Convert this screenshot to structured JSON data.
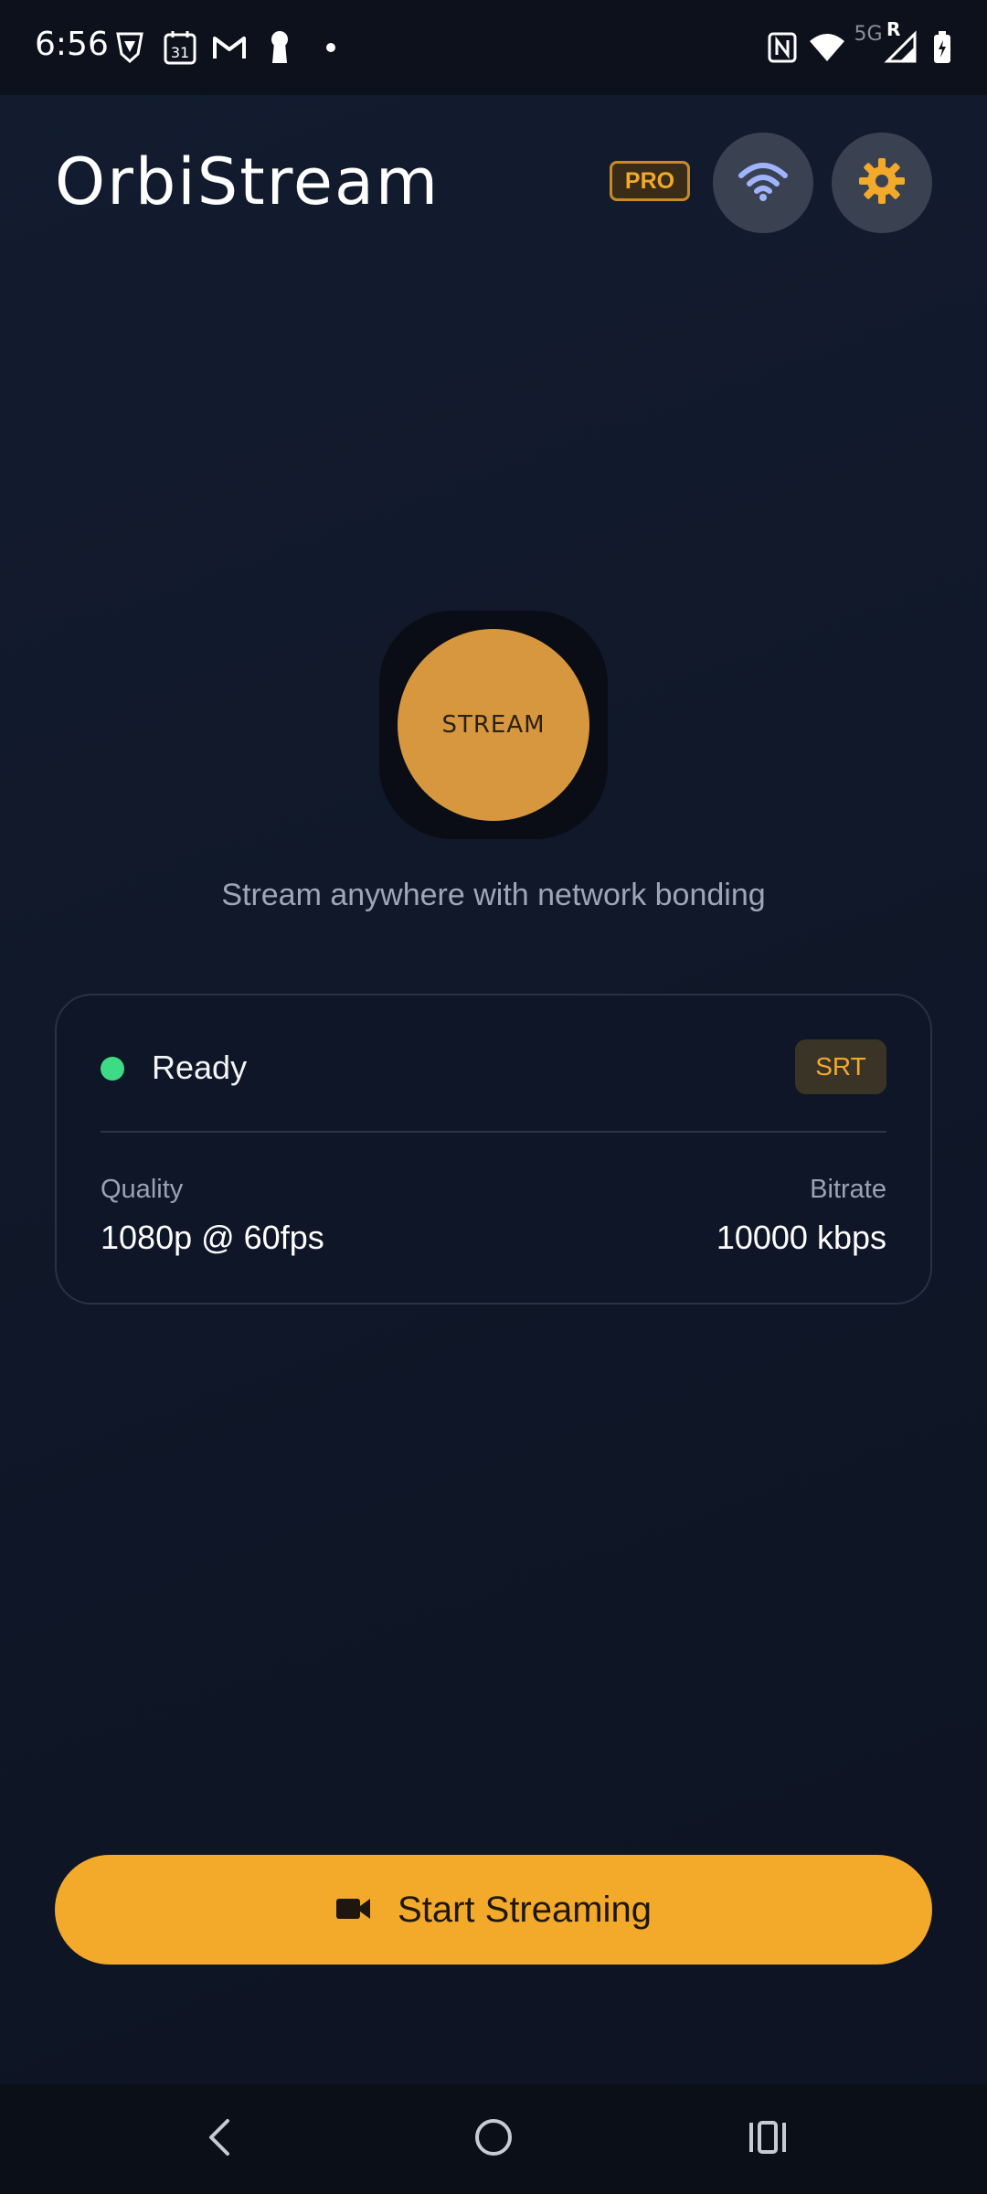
{
  "status_bar": {
    "time": "6:56",
    "left_icons": [
      "brave-icon",
      "calendar-icon",
      "gmail-icon",
      "keyhole-icon",
      "dot-icon"
    ],
    "calendar_day": "31",
    "network_label": "5G",
    "roaming_label": "R",
    "right_icons": [
      "nfc-icon",
      "wifi-icon",
      "cellular-signal-icon",
      "battery-charging-icon"
    ]
  },
  "header": {
    "title": "OrbiStream",
    "pro_badge": "PRO",
    "wifi_button_icon": "wifi-icon",
    "settings_button_icon": "gear-icon"
  },
  "hero": {
    "logo_text": "STREAM",
    "tagline": "Stream anywhere with network bonding"
  },
  "status_card": {
    "status": "Ready",
    "protocol": "SRT",
    "quality_label": "Quality",
    "quality_value": "1080p @ 60fps",
    "bitrate_label": "Bitrate",
    "bitrate_value": "10000 kbps"
  },
  "start_button": {
    "label": "Start Streaming",
    "icon": "video-camera-icon"
  },
  "nav": {
    "items": [
      "back-icon",
      "home-icon",
      "recents-icon"
    ]
  },
  "colors": {
    "accent": "#f3aa2a",
    "ready": "#3ddc84",
    "background": "#111a2c",
    "wifi_icon": "#9fb3ff"
  }
}
